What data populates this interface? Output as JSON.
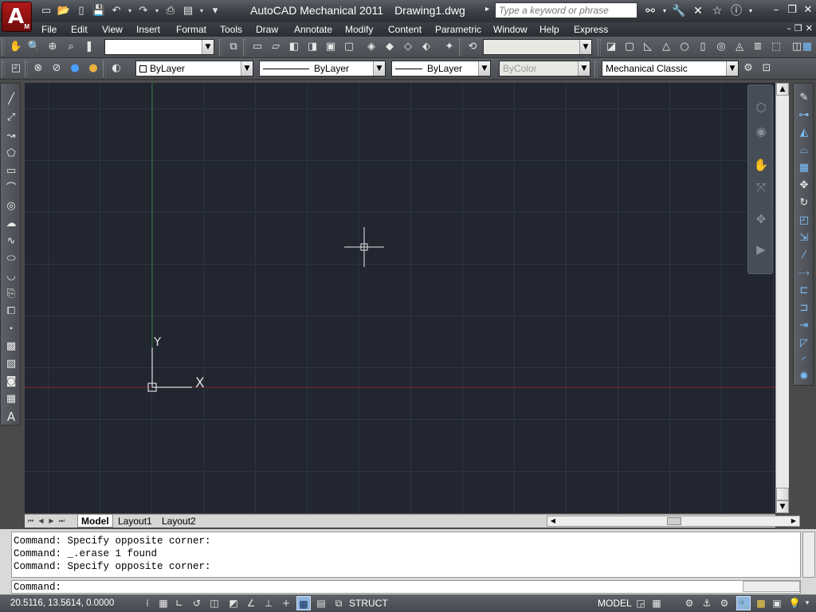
{
  "app": {
    "title": "AutoCAD Mechanical 2011",
    "document": "Drawing1.dwg",
    "search_placeholder": "Type a keyword or phrase"
  },
  "menu": [
    "File",
    "Edit",
    "View",
    "Insert",
    "Format",
    "Tools",
    "Draw",
    "Annotate",
    "Modify",
    "Content",
    "Parametric",
    "Window",
    "Help",
    "Express"
  ],
  "toolbar2": {
    "color": "ByLayer",
    "linetype": "ByLayer",
    "lineweight": "ByLayer",
    "plotstyle": "ByColor",
    "workspace": "Mechanical Classic"
  },
  "canvas": {
    "ucs_x_label": "X",
    "ucs_y_label": "Y",
    "background": "#212630",
    "x_axis_color": "#9a2a2a",
    "y_axis_color": "#2a7a3a"
  },
  "layout_tabs": [
    "Model",
    "Layout1",
    "Layout2"
  ],
  "command": {
    "history": [
      "Command: Specify opposite corner:",
      "Command: _.erase 1 found",
      "Command: Specify opposite corner:"
    ],
    "prompt": "Command:"
  },
  "status": {
    "coordinates": "20.5116, 13.5614, 0.0000",
    "struct_label": "STRUCT",
    "model_label": "MODEL"
  },
  "icons": {
    "qat": [
      "new-icon",
      "open-icon",
      "save-icon",
      "undo-icon",
      "redo-icon",
      "plot-icon",
      "dropdown-icon"
    ],
    "draw": [
      "line-icon",
      "construction-line-icon",
      "polyline-icon",
      "polygon-icon",
      "rectangle-icon",
      "arc-icon",
      "circle-icon",
      "revcloud-icon",
      "spline-icon",
      "ellipse-icon",
      "ellipse-arc-icon",
      "insert-block-icon",
      "make-block-icon",
      "point-icon",
      "hatch-icon",
      "gradient-icon",
      "region-icon",
      "table-icon",
      "mtext-icon"
    ],
    "modify": [
      "erase-icon",
      "copy-icon",
      "mirror-icon",
      "offset-icon",
      "array-icon",
      "move-icon",
      "rotate-icon",
      "scale-icon",
      "stretch-icon",
      "trim-icon",
      "extend-icon",
      "break-at-point-icon",
      "break-icon",
      "join-icon",
      "chamfer-icon",
      "fillet-icon",
      "explode-icon"
    ]
  }
}
